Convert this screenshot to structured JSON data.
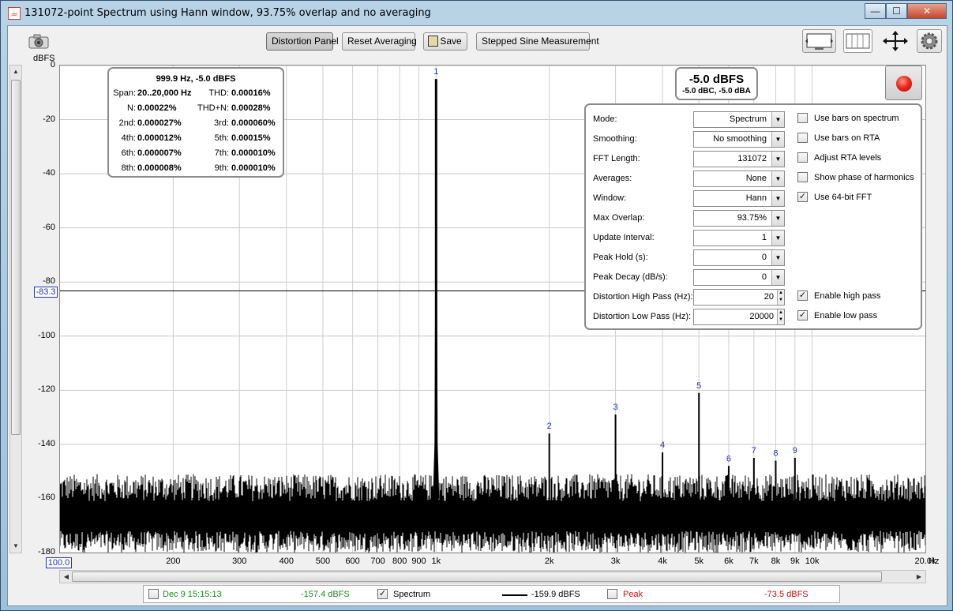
{
  "window": {
    "title": "131072-point Spectrum using Hann window, 93.75% overlap and no averaging",
    "min_glyph": "—",
    "max_glyph": "☐",
    "close_glyph": "✕"
  },
  "toolbar": {
    "distortion_panel": "Distortion Panel",
    "reset_averaging": "Reset Averaging",
    "save": "Save",
    "stepped_sine": "Stepped Sine Measurement"
  },
  "plot": {
    "y_unit": "dBFS",
    "x_unit": "Hz",
    "ref_level": "-83.3",
    "x_start": "100.0"
  },
  "summary": {
    "header": "999.9 Hz, -5.0 dBFS",
    "rows": [
      {
        "l1": "Span:",
        "v1": "20..20,000 Hz",
        "l2": "THD:",
        "v2": "0.00016%"
      },
      {
        "l1": "N:",
        "v1": "0.00022%",
        "l2": "THD+N:",
        "v2": "0.00028%"
      },
      {
        "l1": "2nd:",
        "v1": "0.000027%",
        "l2": "3rd:",
        "v2": "0.000060%"
      },
      {
        "l1": "4th:",
        "v1": "0.000012%",
        "l2": "5th:",
        "v2": "0.00015%"
      },
      {
        "l1": "6th:",
        "v1": "0.000007%",
        "l2": "7th:",
        "v2": "0.000010%"
      },
      {
        "l1": "8th:",
        "v1": "0.000008%",
        "l2": "9th:",
        "v2": "0.000010%"
      }
    ]
  },
  "level": {
    "main": "-5.0 dBFS",
    "sub": "-5.0 dBC, -5.0 dBA"
  },
  "settings": {
    "rows": [
      {
        "label": "Mode:",
        "value": "Spectrum",
        "control": "dropdown"
      },
      {
        "label": "Smoothing:",
        "value": "No  smoothing",
        "control": "dropdown"
      },
      {
        "label": "FFT Length:",
        "value": "131072",
        "control": "dropdown"
      },
      {
        "label": "Averages:",
        "value": "None",
        "control": "dropdown"
      },
      {
        "label": "Window:",
        "value": "Hann",
        "control": "dropdown"
      },
      {
        "label": "Max Overlap:",
        "value": "93.75%",
        "control": "dropdown"
      },
      {
        "label": "Update Interval:",
        "value": "1",
        "control": "dropdown"
      },
      {
        "label": "Peak Hold (s):",
        "value": "0",
        "control": "dropdown"
      },
      {
        "label": "Peak Decay (dB/s):",
        "value": "0",
        "control": "dropdown"
      },
      {
        "label": "Distortion High Pass (Hz):",
        "value": "20",
        "control": "spinner"
      },
      {
        "label": "Distortion Low Pass (Hz):",
        "value": "20000",
        "control": "spinner"
      }
    ],
    "options": [
      {
        "label": "Use bars on spectrum",
        "checked": false
      },
      {
        "label": "Use bars on RTA",
        "checked": false
      },
      {
        "label": "Adjust RTA levels",
        "checked": false
      },
      {
        "label": "Show phase of harmonics",
        "checked": false
      },
      {
        "label": "Use 64-bit FFT",
        "checked": true
      }
    ],
    "filter_options": [
      {
        "label": "Enable high pass",
        "checked": true
      },
      {
        "label": "Enable low pass",
        "checked": true
      }
    ]
  },
  "legend": {
    "snapshot_label": "Dec 9 15:15:13",
    "snapshot_value": "-157.4 dBFS",
    "snapshot_color": "#1e8a1e",
    "spectrum_label": "Spectrum",
    "spectrum_value": "-159.9 dBFS",
    "peak_label": "Peak",
    "peak_value": "-73.5 dBFS",
    "peak_color": "#cc1111"
  },
  "chart_data": {
    "type": "line",
    "x_scale": "log",
    "xlim": [
      100,
      20000
    ],
    "ylim": [
      -180,
      0
    ],
    "yticks": [
      0,
      -20,
      -40,
      -60,
      -80,
      -100,
      -120,
      -140,
      -160,
      -180
    ],
    "xtick_labels": [
      "200",
      "300",
      "400",
      "500",
      "600",
      "700",
      "800",
      "900",
      "1k",
      "2k",
      "3k",
      "4k",
      "5k",
      "6k",
      "7k",
      "8k",
      "9k",
      "10k",
      "20.0k"
    ],
    "xtick_values": [
      200,
      300,
      400,
      500,
      600,
      700,
      800,
      900,
      1000,
      2000,
      3000,
      4000,
      5000,
      6000,
      7000,
      8000,
      9000,
      10000,
      20000
    ],
    "ylabel": "dBFS",
    "xlabel": "Hz",
    "grid": true,
    "ref_line_db": -83.3,
    "noise_floor_db": -165,
    "series": [
      {
        "name": "Spectrum",
        "color": "#000000"
      }
    ],
    "harmonics": [
      {
        "label": "1",
        "freq": 1000,
        "db": -5
      },
      {
        "label": "2",
        "freq": 2000,
        "db": -136
      },
      {
        "label": "3",
        "freq": 3000,
        "db": -129
      },
      {
        "label": "4",
        "freq": 4000,
        "db": -143
      },
      {
        "label": "5",
        "freq": 5000,
        "db": -121
      },
      {
        "label": "6",
        "freq": 6000,
        "db": -148
      },
      {
        "label": "7",
        "freq": 7000,
        "db": -145
      },
      {
        "label": "8",
        "freq": 8000,
        "db": -146
      },
      {
        "label": "9",
        "freq": 9000,
        "db": -145
      }
    ]
  }
}
